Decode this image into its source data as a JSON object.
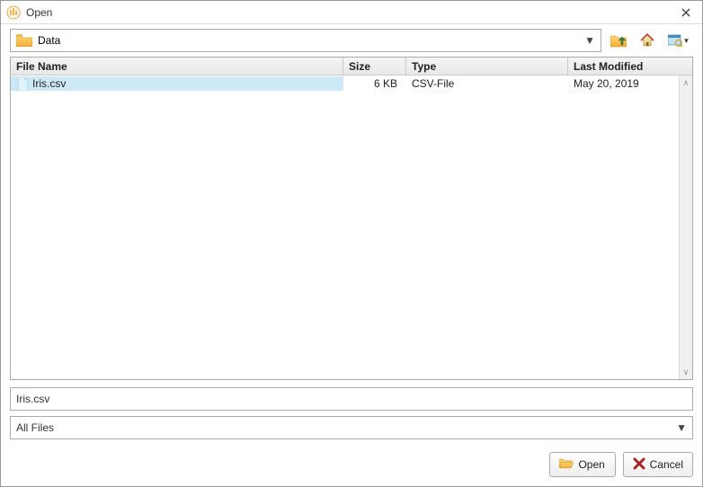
{
  "window": {
    "title": "Open"
  },
  "location": {
    "folder": "Data"
  },
  "table": {
    "headers": {
      "filename": "File Name",
      "size": "Size",
      "type": "Type",
      "modified": "Last Modified"
    },
    "rows": [
      {
        "filename": "Iris.csv",
        "size": "6 KB",
        "type": "CSV-File",
        "modified": "May 20, 2019",
        "selected": true
      }
    ]
  },
  "footer": {
    "filename_value": "Iris.csv",
    "filter_value": "All Files"
  },
  "buttons": {
    "open": "Open",
    "cancel": "Cancel"
  }
}
